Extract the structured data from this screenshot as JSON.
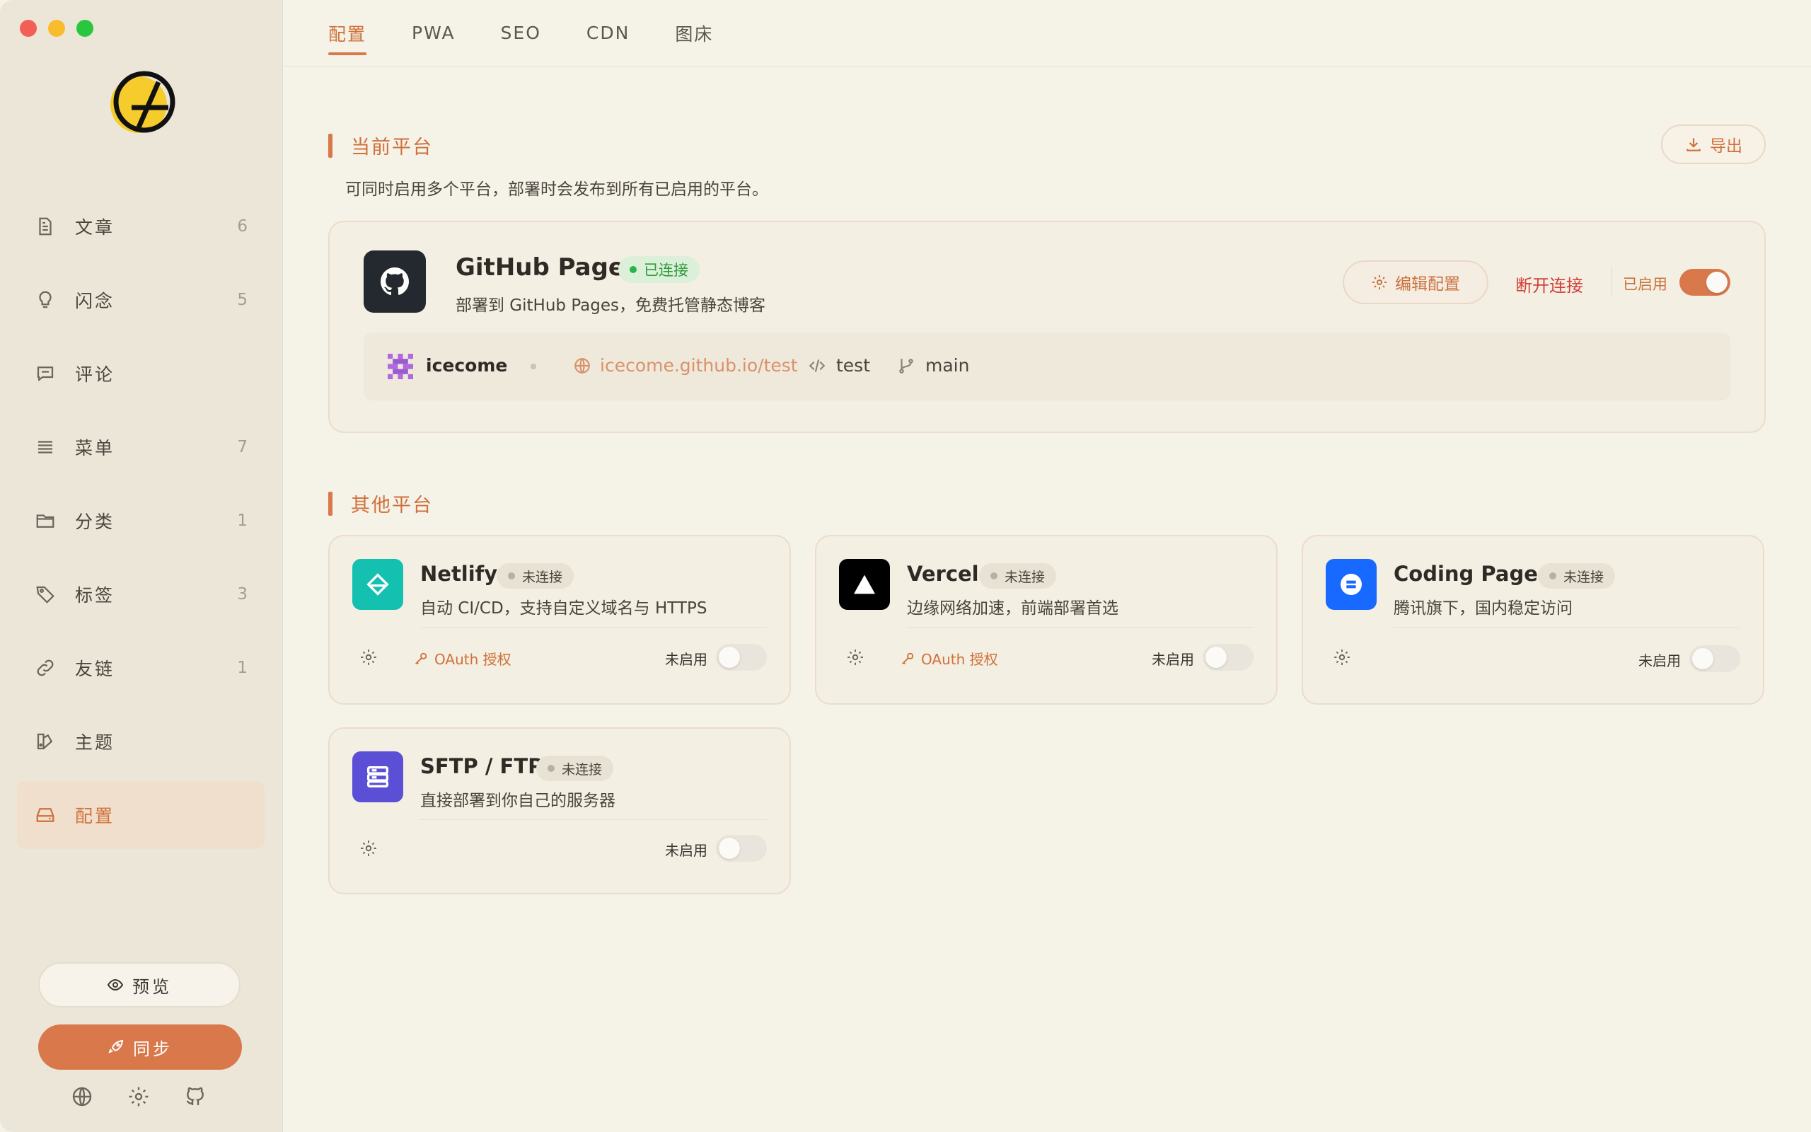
{
  "sidebar": {
    "items": [
      {
        "label": "文章",
        "count": "6",
        "icon": "document-icon"
      },
      {
        "label": "闪念",
        "count": "5",
        "icon": "lightbulb-icon"
      },
      {
        "label": "评论",
        "count": "",
        "icon": "comment-icon"
      },
      {
        "label": "菜单",
        "count": "7",
        "icon": "menu-icon"
      },
      {
        "label": "分类",
        "count": "1",
        "icon": "folder-icon"
      },
      {
        "label": "标签",
        "count": "3",
        "icon": "tag-icon"
      },
      {
        "label": "友链",
        "count": "1",
        "icon": "link-icon"
      },
      {
        "label": "主题",
        "count": "",
        "icon": "theme-icon"
      },
      {
        "label": "配置",
        "count": "",
        "icon": "settings-drive-icon",
        "active": true
      }
    ],
    "preview_label": "预览",
    "sync_label": "同步"
  },
  "tabs": [
    "配置",
    "PWA",
    "SEO",
    "CDN",
    "图床"
  ],
  "current": {
    "title": "当前平台",
    "desc": "可同时启用多个平台，部署时会发布到所有已启用的平台。",
    "export_label": "导出",
    "platform": {
      "name": "GitHub Pages",
      "status": "已连接",
      "desc": "部署到 GitHub Pages，免费托管静态博客",
      "edit_label": "编辑配置",
      "disconnect_label": "断开连接",
      "enabled_label": "已启用",
      "enabled": true,
      "user": "icecome",
      "url": "icecome.github.io/test",
      "repo": "test",
      "branch": "main"
    }
  },
  "others": {
    "title": "其他平台",
    "platforms": [
      {
        "name": "Netlify",
        "status": "未连接",
        "desc": "自动 CI/CD，支持自定义域名与 HTTPS",
        "oauth": "OAuth 授权",
        "off_label": "未启用",
        "color": "#14c0b0"
      },
      {
        "name": "Vercel",
        "status": "未连接",
        "desc": "边缘网络加速，前端部署首选",
        "oauth": "OAuth 授权",
        "off_label": "未启用",
        "color": "#000000"
      },
      {
        "name": "Coding Pages",
        "status": "未连接",
        "desc": "腾讯旗下，国内稳定访问",
        "oauth": "",
        "off_label": "未启用",
        "color": "#1769ff"
      },
      {
        "name": "SFTP / FTP",
        "status": "未连接",
        "desc": "直接部署到你自己的服务器",
        "oauth": "",
        "off_label": "未启用",
        "color": "#5b4fd6"
      }
    ]
  },
  "colors": {
    "accent": "#d9784a",
    "bg": "#f5f2e8",
    "sidebar": "#ece6d8"
  }
}
